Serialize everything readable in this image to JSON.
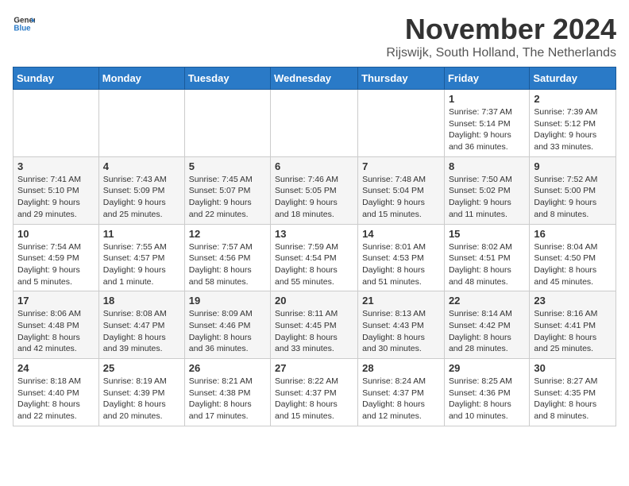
{
  "header": {
    "logo_general": "General",
    "logo_blue": "Blue",
    "month_title": "November 2024",
    "location": "Rijswijk, South Holland, The Netherlands"
  },
  "weekdays": [
    "Sunday",
    "Monday",
    "Tuesday",
    "Wednesday",
    "Thursday",
    "Friday",
    "Saturday"
  ],
  "weeks": [
    [
      {
        "day": "",
        "info": ""
      },
      {
        "day": "",
        "info": ""
      },
      {
        "day": "",
        "info": ""
      },
      {
        "day": "",
        "info": ""
      },
      {
        "day": "",
        "info": ""
      },
      {
        "day": "1",
        "info": "Sunrise: 7:37 AM\nSunset: 5:14 PM\nDaylight: 9 hours and 36 minutes."
      },
      {
        "day": "2",
        "info": "Sunrise: 7:39 AM\nSunset: 5:12 PM\nDaylight: 9 hours and 33 minutes."
      }
    ],
    [
      {
        "day": "3",
        "info": "Sunrise: 7:41 AM\nSunset: 5:10 PM\nDaylight: 9 hours and 29 minutes."
      },
      {
        "day": "4",
        "info": "Sunrise: 7:43 AM\nSunset: 5:09 PM\nDaylight: 9 hours and 25 minutes."
      },
      {
        "day": "5",
        "info": "Sunrise: 7:45 AM\nSunset: 5:07 PM\nDaylight: 9 hours and 22 minutes."
      },
      {
        "day": "6",
        "info": "Sunrise: 7:46 AM\nSunset: 5:05 PM\nDaylight: 9 hours and 18 minutes."
      },
      {
        "day": "7",
        "info": "Sunrise: 7:48 AM\nSunset: 5:04 PM\nDaylight: 9 hours and 15 minutes."
      },
      {
        "day": "8",
        "info": "Sunrise: 7:50 AM\nSunset: 5:02 PM\nDaylight: 9 hours and 11 minutes."
      },
      {
        "day": "9",
        "info": "Sunrise: 7:52 AM\nSunset: 5:00 PM\nDaylight: 9 hours and 8 minutes."
      }
    ],
    [
      {
        "day": "10",
        "info": "Sunrise: 7:54 AM\nSunset: 4:59 PM\nDaylight: 9 hours and 5 minutes."
      },
      {
        "day": "11",
        "info": "Sunrise: 7:55 AM\nSunset: 4:57 PM\nDaylight: 9 hours and 1 minute."
      },
      {
        "day": "12",
        "info": "Sunrise: 7:57 AM\nSunset: 4:56 PM\nDaylight: 8 hours and 58 minutes."
      },
      {
        "day": "13",
        "info": "Sunrise: 7:59 AM\nSunset: 4:54 PM\nDaylight: 8 hours and 55 minutes."
      },
      {
        "day": "14",
        "info": "Sunrise: 8:01 AM\nSunset: 4:53 PM\nDaylight: 8 hours and 51 minutes."
      },
      {
        "day": "15",
        "info": "Sunrise: 8:02 AM\nSunset: 4:51 PM\nDaylight: 8 hours and 48 minutes."
      },
      {
        "day": "16",
        "info": "Sunrise: 8:04 AM\nSunset: 4:50 PM\nDaylight: 8 hours and 45 minutes."
      }
    ],
    [
      {
        "day": "17",
        "info": "Sunrise: 8:06 AM\nSunset: 4:48 PM\nDaylight: 8 hours and 42 minutes."
      },
      {
        "day": "18",
        "info": "Sunrise: 8:08 AM\nSunset: 4:47 PM\nDaylight: 8 hours and 39 minutes."
      },
      {
        "day": "19",
        "info": "Sunrise: 8:09 AM\nSunset: 4:46 PM\nDaylight: 8 hours and 36 minutes."
      },
      {
        "day": "20",
        "info": "Sunrise: 8:11 AM\nSunset: 4:45 PM\nDaylight: 8 hours and 33 minutes."
      },
      {
        "day": "21",
        "info": "Sunrise: 8:13 AM\nSunset: 4:43 PM\nDaylight: 8 hours and 30 minutes."
      },
      {
        "day": "22",
        "info": "Sunrise: 8:14 AM\nSunset: 4:42 PM\nDaylight: 8 hours and 28 minutes."
      },
      {
        "day": "23",
        "info": "Sunrise: 8:16 AM\nSunset: 4:41 PM\nDaylight: 8 hours and 25 minutes."
      }
    ],
    [
      {
        "day": "24",
        "info": "Sunrise: 8:18 AM\nSunset: 4:40 PM\nDaylight: 8 hours and 22 minutes."
      },
      {
        "day": "25",
        "info": "Sunrise: 8:19 AM\nSunset: 4:39 PM\nDaylight: 8 hours and 20 minutes."
      },
      {
        "day": "26",
        "info": "Sunrise: 8:21 AM\nSunset: 4:38 PM\nDaylight: 8 hours and 17 minutes."
      },
      {
        "day": "27",
        "info": "Sunrise: 8:22 AM\nSunset: 4:37 PM\nDaylight: 8 hours and 15 minutes."
      },
      {
        "day": "28",
        "info": "Sunrise: 8:24 AM\nSunset: 4:37 PM\nDaylight: 8 hours and 12 minutes."
      },
      {
        "day": "29",
        "info": "Sunrise: 8:25 AM\nSunset: 4:36 PM\nDaylight: 8 hours and 10 minutes."
      },
      {
        "day": "30",
        "info": "Sunrise: 8:27 AM\nSunset: 4:35 PM\nDaylight: 8 hours and 8 minutes."
      }
    ]
  ]
}
